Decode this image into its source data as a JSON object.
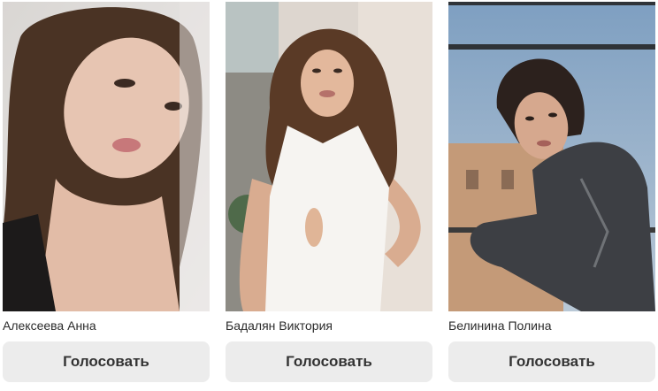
{
  "contestants": [
    {
      "name": "Алексеева Анна",
      "vote_label": "Голосовать",
      "photo_icon": "portrait-photo"
    },
    {
      "name": "Бадалян Виктория",
      "vote_label": "Голосовать",
      "photo_icon": "portrait-photo"
    },
    {
      "name": "Белинина Полина",
      "vote_label": "Голосовать",
      "photo_icon": "portrait-photo"
    }
  ],
  "colors": {
    "button_bg": "#ececec",
    "button_text": "#333333",
    "name_text": "#2b2b2b"
  }
}
